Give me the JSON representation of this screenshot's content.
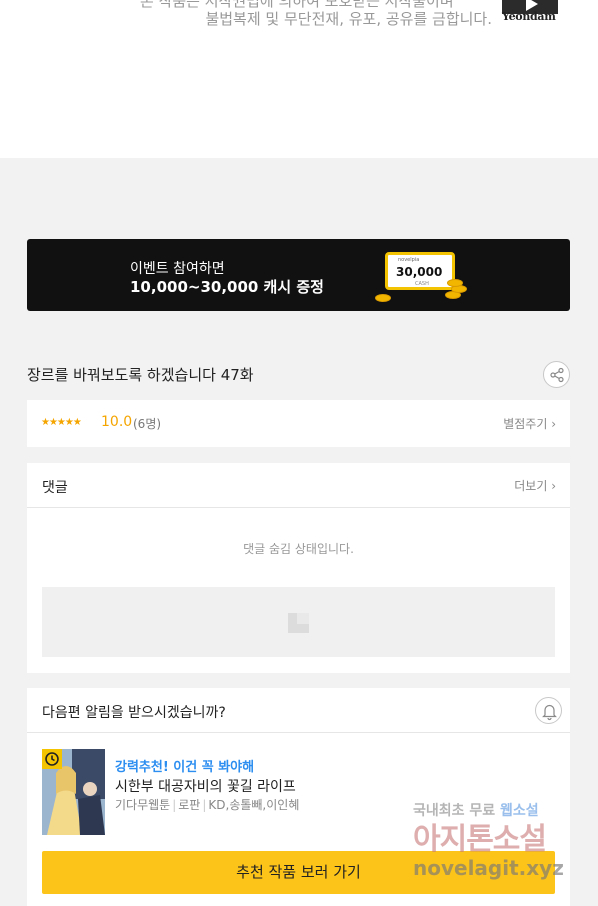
{
  "copyright": {
    "line1": "본 작품은 저작권법에 의하여 보호받는 저작물이며",
    "line2": "불법복제 및 무단전재, 유포, 공유를 금합니다.",
    "publisher_logo": "Yeondam"
  },
  "event_banner": {
    "line1": "이벤트 참여하면",
    "line2": "10,000~30,000 캐시 증정",
    "card_brand": "novelpia",
    "card_amount": "30,000",
    "card_label": "CASH"
  },
  "episode": {
    "title": "장르를 바꿔보도록 하겠습니다 47화",
    "stars": "★★★★★",
    "score": "10.0",
    "count": "(6명)",
    "rate_link": "별점주기 ›"
  },
  "comments": {
    "title": "댓글",
    "more": "더보기 ›",
    "hidden_message": "댓글 숨김 상태입니다."
  },
  "next_notice": {
    "question": "다음편 알림을 받으시겠습니까?",
    "recommend_tag": "강력추천! 이건 꼭 봐야해",
    "work_title": "시한부 대공자비의 꽃길 라이프",
    "meta": [
      "기다무웹툰",
      "로판",
      "KD,송톨빼,이인혜"
    ],
    "cta": "추천 작품 보러 가기"
  },
  "watermark": {
    "line1_a": "국내최초 무료 ",
    "line1_b": "웹소설",
    "line2": "아지톤소설",
    "line3": "novelagit.xyz"
  }
}
